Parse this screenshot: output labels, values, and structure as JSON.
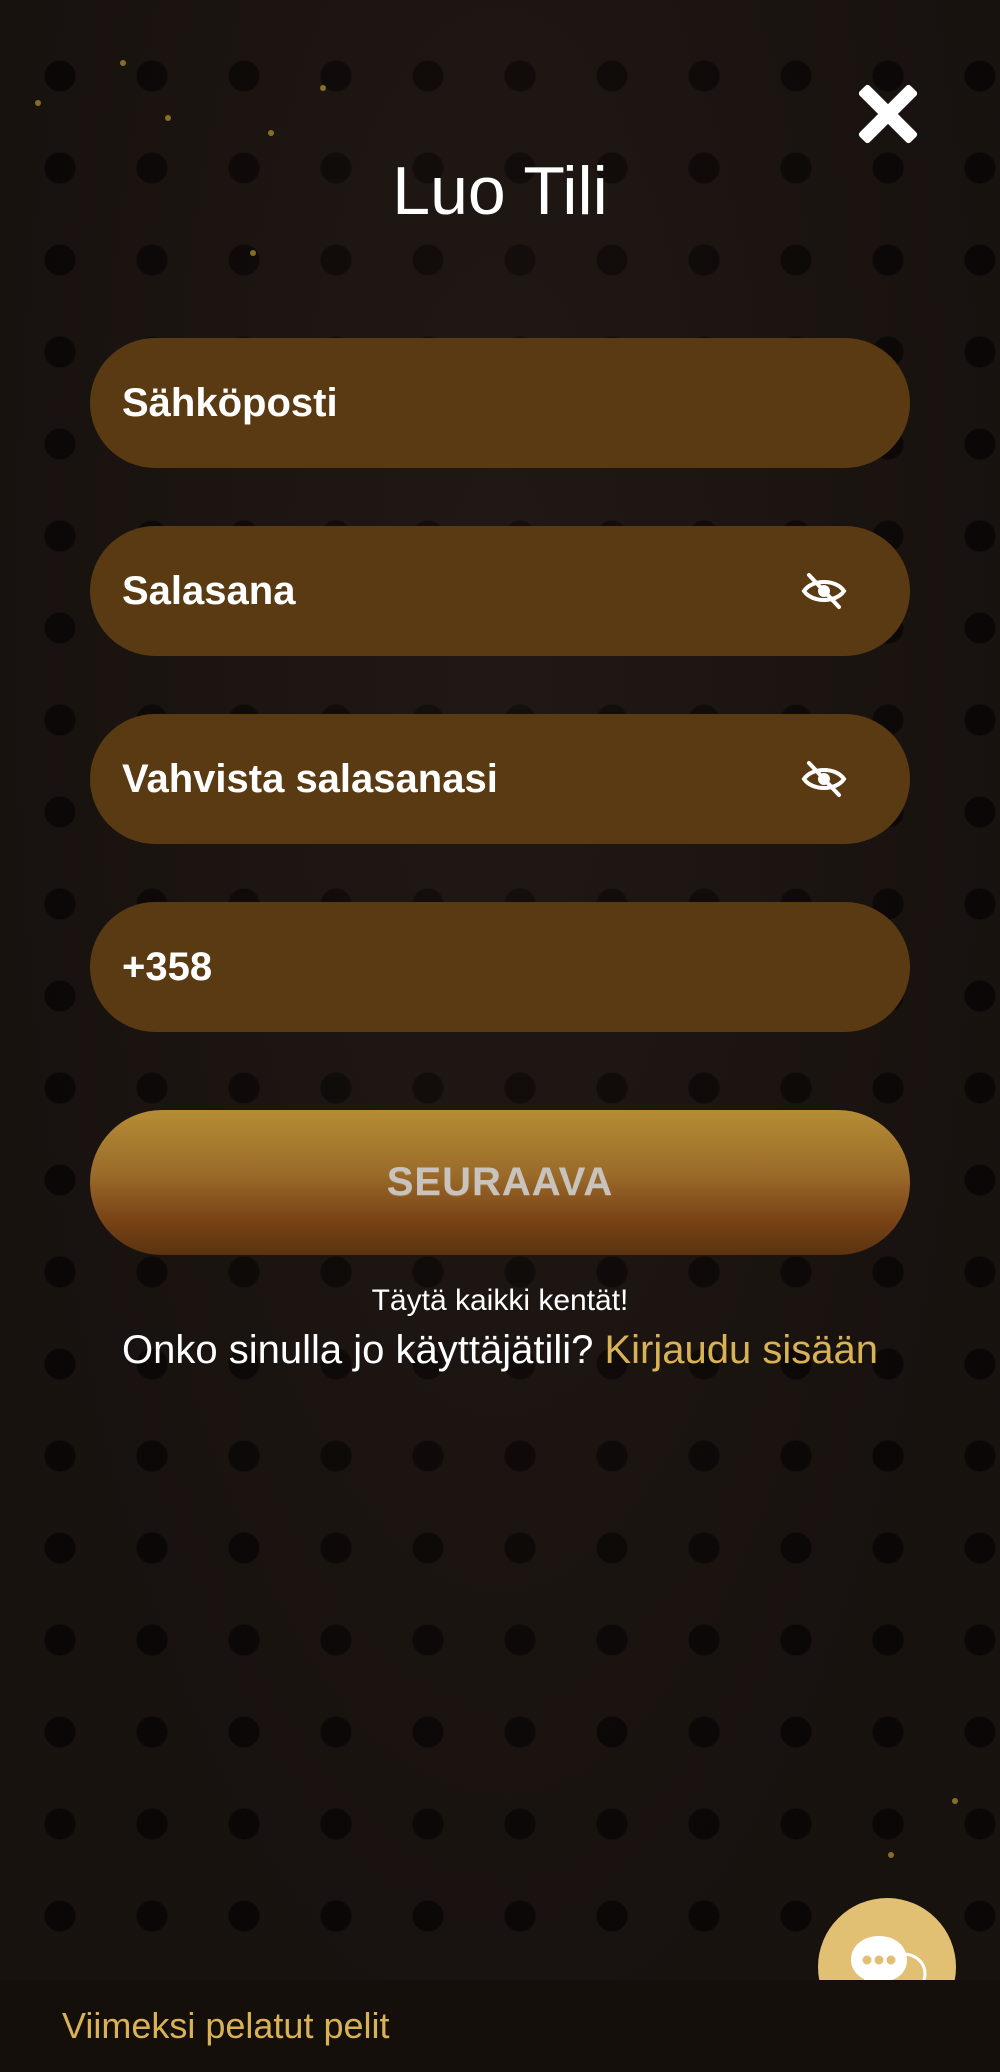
{
  "modal": {
    "title": "Luo Tili",
    "close_icon": "close-icon"
  },
  "form": {
    "email": {
      "placeholder": "Sähköposti",
      "value": ""
    },
    "password": {
      "placeholder": "Salasana",
      "value": "",
      "toggle_icon": "eye-off-icon"
    },
    "confirm_password": {
      "placeholder": "Vahvista salasanasi",
      "value": "",
      "toggle_icon": "eye-off-icon"
    },
    "phone": {
      "placeholder": "",
      "value": "+358"
    },
    "submit_label": "SEURAAVA",
    "hint": "Täytä kaikki kentät!",
    "login_prompt": "Onko sinulla jo käyttäjätili?",
    "login_link": "Kirjaudu sisään"
  },
  "chat": {
    "icon": "chat-bubbles-icon"
  },
  "bottom_bar": {
    "label": "Viimeksi pelatut pelit"
  },
  "colors": {
    "background": "#1c1512",
    "field": "#5a3a12",
    "accent_gold": "#d9b255",
    "chat_button": "#e1c073",
    "text": "#ffffff"
  }
}
